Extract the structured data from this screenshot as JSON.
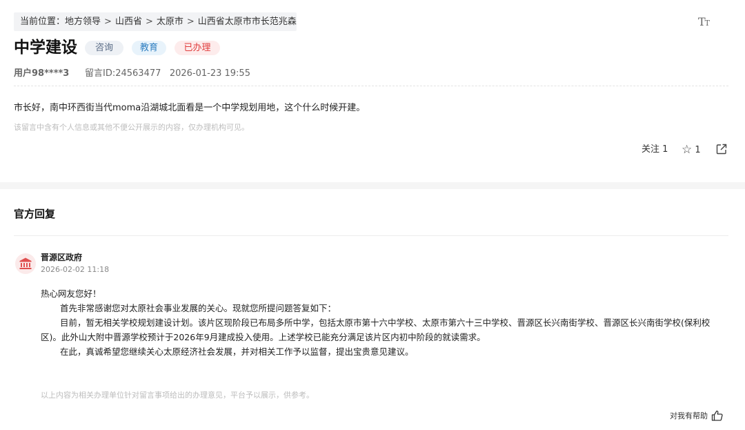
{
  "breadcrumb": {
    "prefix": "当前位置：",
    "items": [
      "地方领导",
      "山西省",
      "太原市",
      "山西省太原市市长范兆森"
    ],
    "separator": ">"
  },
  "font_toggle": {
    "big": "T",
    "small": "T"
  },
  "post": {
    "title": "中学建设",
    "tags": [
      "咨询",
      "教育",
      "已办理"
    ],
    "user": "用户98****3",
    "message_id": "留言ID:24563477",
    "datetime": "2026-01-23 19:55",
    "content": "市长好，南中环西街当代moma沿湖城北面看是一个中学规划用地，这个什么时候开建。",
    "privacy_note": "该留言中含有个人信息或其他不便公开展示的内容，仅办理机构可见。"
  },
  "actions": {
    "follow_label": "关注 1",
    "star_glyph": "☆",
    "star_count": "1"
  },
  "reply": {
    "heading": "官方回复",
    "org": "晋源区政府",
    "datetime": "2026-02-02 11:18",
    "greeting": "热心网友您好！",
    "paragraphs": [
      "首先非常感谢您对太原社会事业发展的关心。现就您所提问题答复如下：",
      "目前，暂无相关学校规划建设计划。该片区现阶段已布局多所中学，包括太原市第十六中学校、太原市第六十三中学校、晋源区长兴南街学校、晋源区长兴南街学校(保利校区)。此外山大附中晋源学校预计于2026年9月建成投入使用。上述学校已能充分满足该片区内初中阶段的就读需求。",
      "在此，真诚希望您继续关心太原经济社会发展，并对相关工作予以监督，提出宝贵意见建议。"
    ],
    "disclaimer": "以上内容为相关办理单位针对留言事项给出的办理意见，平台予以展示，供参考。",
    "helpful_label": "对我有帮助"
  },
  "colors": {
    "tag_consult": "#5a6c86",
    "tag_edu": "#2f7fc1",
    "tag_done": "#e03c3c",
    "avatar_icon": "#e05050"
  }
}
